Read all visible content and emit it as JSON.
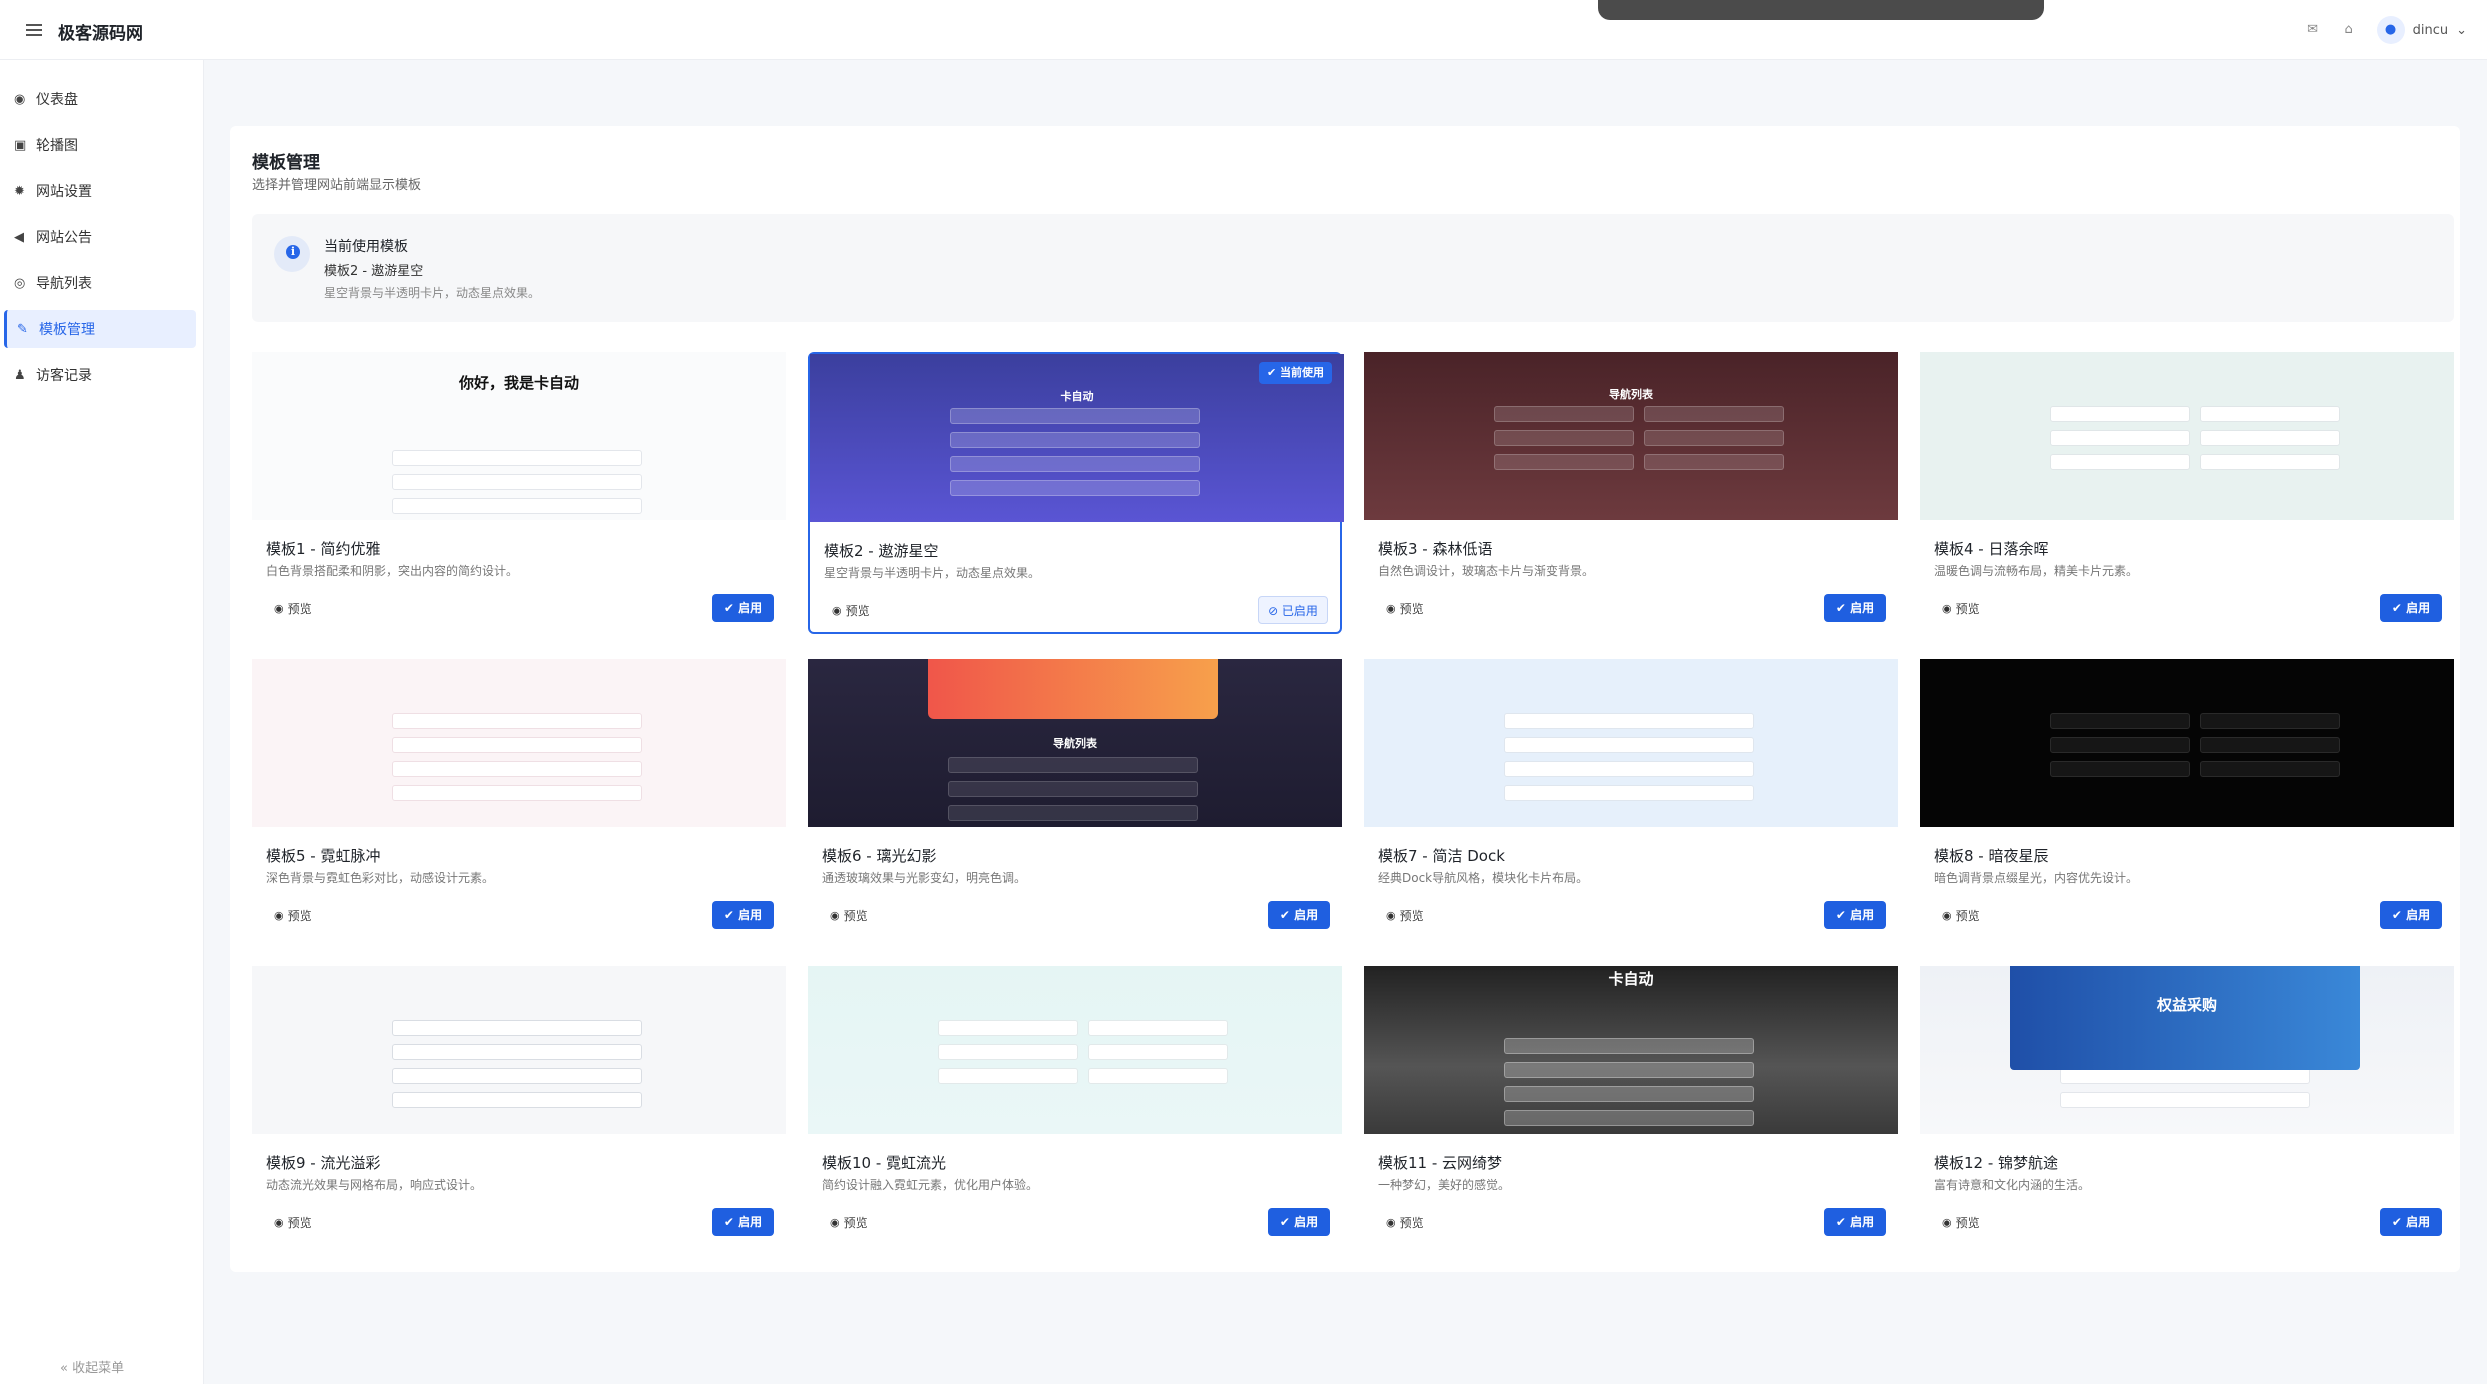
{
  "app": {
    "brand": "极客源码网"
  },
  "header": {
    "username": "dincu"
  },
  "sidebar": {
    "items": [
      {
        "label": "仪表盘",
        "icon": "dashboard-icon",
        "glyph": "◉"
      },
      {
        "label": "轮播图",
        "icon": "image-icon",
        "glyph": "▣"
      },
      {
        "label": "网站设置",
        "icon": "gear-icon",
        "glyph": "✹"
      },
      {
        "label": "网站公告",
        "icon": "megaphone-icon",
        "glyph": "◀"
      },
      {
        "label": "导航列表",
        "icon": "compass-icon",
        "glyph": "◎"
      },
      {
        "label": "模板管理",
        "icon": "brush-icon",
        "glyph": "✎"
      },
      {
        "label": "访客记录",
        "icon": "users-icon",
        "glyph": "♟"
      }
    ],
    "collapse_label": "收起菜单"
  },
  "page": {
    "title": "模板管理",
    "subtitle": "选择并管理网站前端显示模板",
    "current": {
      "label": "当前使用模板",
      "name": "模板2 - 遨游星空",
      "desc": "星空背景与半透明卡片，动态星点效果。"
    },
    "preview_label": "预览",
    "enable_label": "✔ 启用",
    "enabled_label": "⊘ 已启用",
    "current_badge": "✔ 当前使用",
    "templates": [
      {
        "title": "模板1 - 简约优雅",
        "desc": "白色背景搭配柔和阴影，突出内容的简约设计。",
        "thumb_text": "你好，我是卡自动"
      },
      {
        "title": "模板2 - 遨游星空",
        "desc": "星空背景与半透明卡片，动态星点效果。",
        "thumb_text": "卡自动"
      },
      {
        "title": "模板3 - 森林低语",
        "desc": "自然色调设计，玻璃态卡片与渐变背景。",
        "thumb_text": "导航列表"
      },
      {
        "title": "模板4 - 日落余晖",
        "desc": "温暖色调与流畅布局，精美卡片元素。",
        "thumb_text": ""
      },
      {
        "title": "模板5 - 霓虹脉冲",
        "desc": "深色背景与霓虹色彩对比，动感设计元素。",
        "thumb_text": ""
      },
      {
        "title": "模板6 - 璃光幻影",
        "desc": "通透玻璃效果与光影变幻，明亮色调。",
        "thumb_text": "导航列表"
      },
      {
        "title": "模板7 - 简洁 Dock",
        "desc": "经典Dock导航风格，模块化卡片布局。",
        "thumb_text": ""
      },
      {
        "title": "模板8 - 暗夜星辰",
        "desc": "暗色调背景点缀星光，内容优先设计。",
        "thumb_text": ""
      },
      {
        "title": "模板9 - 流光溢彩",
        "desc": "动态流光效果与网格布局，响应式设计。",
        "thumb_text": ""
      },
      {
        "title": "模板10 - 霓虹流光",
        "desc": "简约设计融入霓虹元素，优化用户体验。",
        "thumb_text": ""
      },
      {
        "title": "模板11 - 云网绮梦",
        "desc": "一种梦幻，美好的感觉。",
        "thumb_text": "卡自动"
      },
      {
        "title": "模板12 - 锦梦航途",
        "desc": "富有诗意和文化内涵的生活。",
        "thumb_text": "权益采购"
      }
    ]
  }
}
